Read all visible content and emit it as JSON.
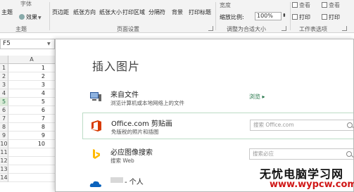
{
  "ribbon": {
    "theme_group": {
      "main_label": "主题",
      "effects_label": "效果",
      "top_partial_label": "字体",
      "group_label": "主题"
    },
    "page_setup": {
      "buttons": [
        "页边距",
        "纸张方向",
        "纸张大小",
        "打印区域",
        "分隔符",
        "背景",
        "打印标题"
      ],
      "group_label": "页面设置"
    },
    "scale_to_fit": {
      "width_partial": "宽度",
      "scale_label": "缩放比例:",
      "scale_value": "100%",
      "group_label": "调整为合适大小"
    },
    "sheet_options": {
      "view_label": "查看",
      "print_label": "打印",
      "view_label2": "查看",
      "print_label2": "打印",
      "group_label": "工作表选项"
    }
  },
  "formula_bar": {
    "name_box": "F5"
  },
  "grid": {
    "column_header": "A",
    "rows": [
      {
        "row": "1",
        "value": "1"
      },
      {
        "row": "2",
        "value": "2"
      },
      {
        "row": "3",
        "value": "3"
      },
      {
        "row": "4",
        "value": "4"
      },
      {
        "row": "5",
        "value": "5"
      },
      {
        "row": "6",
        "value": "6"
      },
      {
        "row": "7",
        "value": "7"
      },
      {
        "row": "8",
        "value": "8"
      },
      {
        "row": "9",
        "value": "9"
      },
      {
        "row": "10",
        "value": "10"
      },
      {
        "row": "11",
        "value": ""
      },
      {
        "row": "12",
        "value": ""
      },
      {
        "row": "13",
        "value": ""
      },
      {
        "row": "14",
        "value": ""
      }
    ]
  },
  "dialog": {
    "title": "插入图片",
    "items": [
      {
        "icon": "computer-icon",
        "title": "来自文件",
        "subtitle": "浏览计算机或本地网络上的文件",
        "action": "浏览 ▸"
      },
      {
        "icon": "office-icon",
        "title": "Office.com 剪贴画",
        "subtitle": "免版税的照片和插图",
        "search_placeholder": "搜索 Office.com"
      },
      {
        "icon": "bing-icon",
        "title": "必应图像搜索",
        "subtitle": "搜索 Web",
        "search_placeholder": "搜索必应"
      },
      {
        "icon": "cloud-icon",
        "title": "- 个人",
        "subtitle": ""
      }
    ]
  },
  "watermark": {
    "line1": "无忧电脑学习网",
    "line2": "www.wypcw.com"
  },
  "colors": {
    "excel_green": "#217346",
    "office_orange": "#d83b01",
    "bing_yellow": "#ffb900",
    "onedrive_blue": "#0a62bd",
    "watermark_red": "#d01717"
  }
}
